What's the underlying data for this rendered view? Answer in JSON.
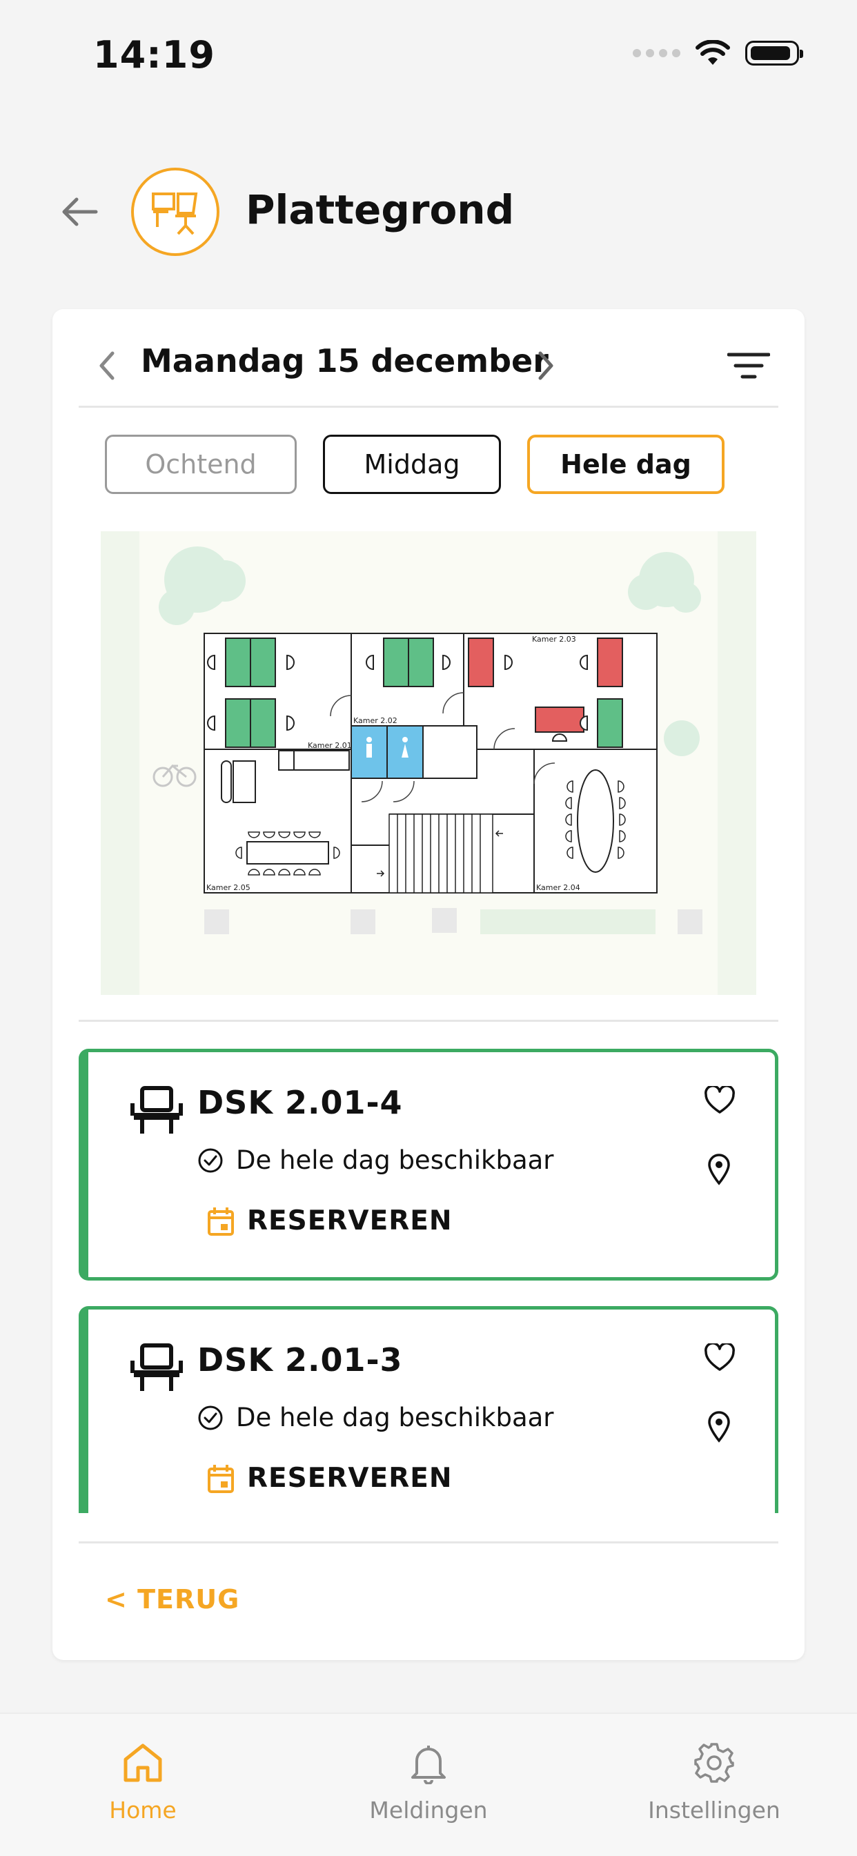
{
  "status_bar": {
    "time": "14:19"
  },
  "header": {
    "title": "Plattegrond"
  },
  "date_nav": {
    "label": "Maandag 15 december"
  },
  "segments": [
    {
      "label": "Ochtend",
      "state": "disabled"
    },
    {
      "label": "Middag",
      "state": "default"
    },
    {
      "label": "Hele dag",
      "state": "selected"
    }
  ],
  "floorplan": {
    "rooms": [
      "Kamer 2.01",
      "Kamer 2.02",
      "Kamer 2.03",
      "Kamer 2.04",
      "Kamer 2.05"
    ]
  },
  "desks": [
    {
      "name": "DSK 2.01-4",
      "availability": "De hele dag beschikbaar",
      "action": "RESERVEREN"
    },
    {
      "name": "DSK 2.01-3",
      "availability": "De hele dag beschikbaar",
      "action": "RESERVEREN"
    }
  ],
  "back_link": "< TERUG",
  "bottom_nav": [
    {
      "label": "Home",
      "icon": "home-icon",
      "active": true
    },
    {
      "label": "Meldingen",
      "icon": "bell-icon",
      "active": false
    },
    {
      "label": "Instellingen",
      "icon": "gear-icon",
      "active": false
    }
  ],
  "colors": {
    "accent": "#f5a623",
    "available": "#3caa62",
    "occupied": "#e35f5f",
    "restroom": "#6ec3ea"
  }
}
